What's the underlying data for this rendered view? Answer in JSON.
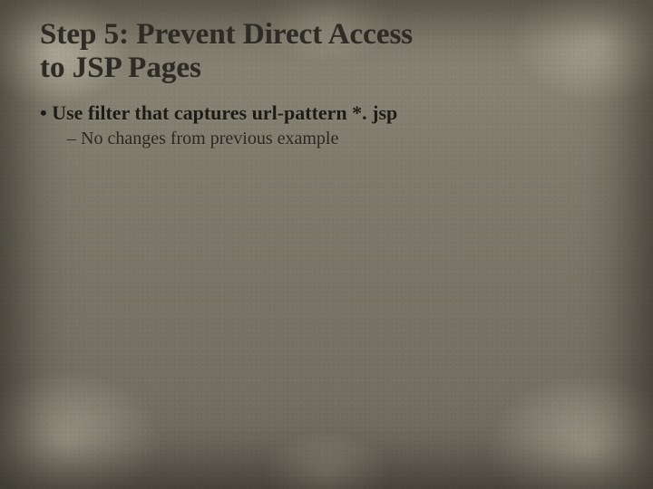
{
  "title_line1": "Step 5: Prevent Direct Access",
  "title_line2": "to JSP Pages",
  "bullet1": "• Use filter that captures url-pattern *. jsp",
  "bullet2": "– No changes from previous example"
}
